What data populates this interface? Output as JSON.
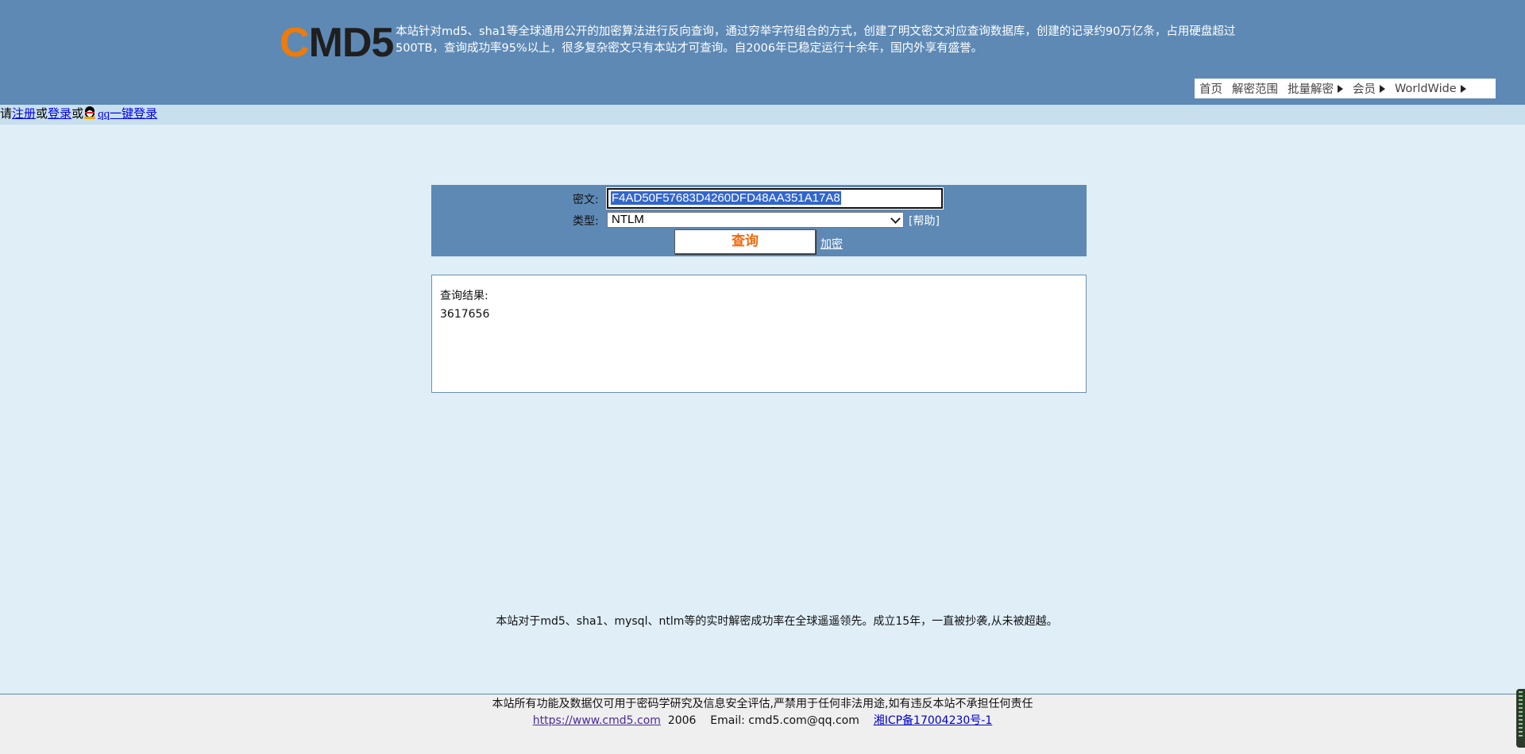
{
  "header": {
    "logo_c": "C",
    "logo_rest": "MD5",
    "intro": "本站针对md5、sha1等全球通用公开的加密算法进行反向查询，通过穷举字符组合的方式，创建了明文密文对应查询数据库，创建的记录约90万亿条，占用硬盘超过500TB，查询成功率95%以上，很多复杂密文只有本站才可查询。自2006年已稳定运行十余年，国内外享有盛誉。",
    "nav": [
      {
        "label": "首页",
        "dropdown": false
      },
      {
        "label": "解密范围",
        "dropdown": false
      },
      {
        "label": "批量解密",
        "dropdown": true
      },
      {
        "label": "会员",
        "dropdown": true
      },
      {
        "label": "WorldWide",
        "dropdown": true
      }
    ]
  },
  "login_bar": {
    "prefix": "请",
    "register": "注册",
    "or1": "或",
    "login": "登录",
    "or2": "或",
    "qq_login": "qq一键登录"
  },
  "search": {
    "cipher_label": "密文:",
    "cipher_value": "F4AD50F57683D4260DFD48AA351A17A8",
    "type_label": "类型:",
    "type_value": "NTLM",
    "help": "[帮助]",
    "query_button": "查询",
    "encrypt_link": "加密"
  },
  "result": {
    "title": "查询结果:",
    "value": "3617656"
  },
  "claim": "本站对于md5、sha1、mysql、ntlm等的实时解密成功率在全球遥遥领先。成立15年，一直被抄袭,从未被超越。",
  "footer": {
    "disclaimer": "本站所有功能及数据仅可用于密码学研究及信息安全评估,严禁用于任何非法用途,如有违反本站不承担任何责任",
    "site_link": "https://www.cmd5.com",
    "year": "2006",
    "email": "Email: cmd5.com@qq.com",
    "icp": "湘ICP备17004230号-1"
  },
  "colors": {
    "header_bg": "#5e89b5",
    "page_bg": "#dfeef7",
    "logo_accent": "#f07b08",
    "button_text": "#f06a0f"
  }
}
